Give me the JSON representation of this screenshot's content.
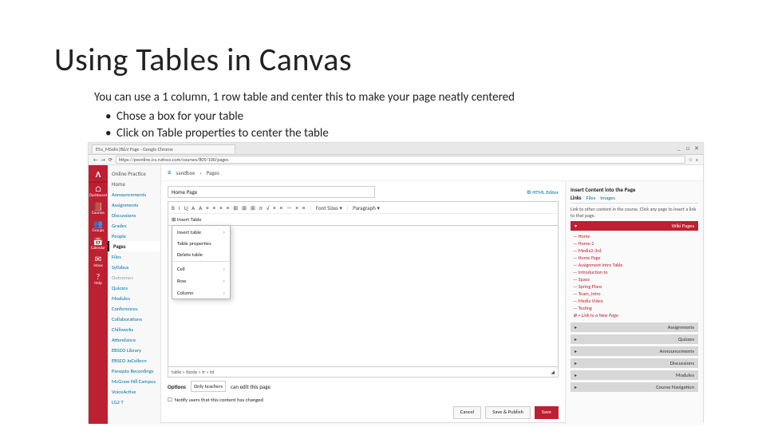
{
  "title": "Using Tables in Canvas",
  "intro": "You can use a 1 column, 1 row table and center this to make your page neatly centered",
  "bullets": [
    "Chose a box for your table",
    "Click on Table properties to center the table"
  ],
  "browser": {
    "tab_title": "E5a_MSolis|B&V Page - Google Chrome",
    "url": "https://pvonline.ics.rutisco.com/courses/805/100/pages",
    "win_icons": [
      "_",
      "□",
      "✕"
    ]
  },
  "rail": [
    {
      "icon": "⌂",
      "label": "Dashboard"
    },
    {
      "icon": "📕",
      "label": "Courses"
    },
    {
      "icon": "👥",
      "label": "Groups"
    },
    {
      "icon": "📅",
      "label": "Calendar"
    },
    {
      "icon": "✉",
      "label": "Inbox"
    },
    {
      "icon": "?",
      "label": "Help"
    }
  ],
  "nav": {
    "head1": "Online Practice",
    "head2": "Home",
    "items": [
      {
        "label": "Announcements"
      },
      {
        "label": "Assignments"
      },
      {
        "label": "Discussions"
      },
      {
        "label": "Grades"
      },
      {
        "label": "People"
      },
      {
        "label": "Pages",
        "active": true
      },
      {
        "label": "Files"
      },
      {
        "label": "Syllabus"
      },
      {
        "label": "Outcomes",
        "dim": true
      },
      {
        "label": "Quizzes"
      },
      {
        "label": "Modules"
      },
      {
        "label": "Conferences"
      },
      {
        "label": "Collaborations"
      },
      {
        "label": "Chiliworks"
      },
      {
        "label": "Attendance"
      },
      {
        "label": "EBSCO Library"
      },
      {
        "label": "EBSCO JoCollecn"
      },
      {
        "label": "Panopto Recordings"
      },
      {
        "label": "McGraw Hill Campus"
      },
      {
        "label": "VoiceActive"
      },
      {
        "label": "LG2 T"
      }
    ]
  },
  "crumb": {
    "course": "sandbox",
    "page": "Pages"
  },
  "page_form": {
    "title_value": "Home Page",
    "html_link": "HTML Editor",
    "fonts_label": "Font Sizes",
    "para_label": "Paragraph",
    "toolbar_icons": [
      "B",
      "I",
      "U̲",
      "A",
      "A",
      "≡",
      "≡",
      "≡",
      "≡",
      "⊞",
      "⊞",
      "⊞",
      "π",
      "√",
      "≡",
      "≡",
      "—",
      "≡",
      "≡"
    ],
    "menu_label": "Insert Table",
    "status_path": "table » tbody » tr » td",
    "options_label": "Options",
    "options_value": "Only teachers",
    "options_suffix": "can edit this page",
    "notify": "Notify users that this content has changed",
    "btn_cancel": "Cancel",
    "btn_pub": "Save & Publish",
    "btn_save": "Save"
  },
  "dropdown": [
    {
      "label": "Insert table",
      "sub": true
    },
    {
      "label": "Table properties"
    },
    {
      "label": "Delete table"
    },
    {
      "hr": true
    },
    {
      "label": "Cell",
      "sub": true
    },
    {
      "label": "Row",
      "sub": true
    },
    {
      "label": "Column",
      "sub": true
    }
  ],
  "insert": {
    "head": "Insert Content into the Page",
    "tabs": [
      "Links",
      "Files",
      "Images"
    ],
    "info": "Link to other content in the course. Click any page to insert a link to that page.",
    "wiki_label": "Wiki Pages",
    "wiki_links": [
      "Home",
      "Home-2",
      "Media2-3rd",
      "Home Page",
      "Assignment Intro Table",
      "Introduction to",
      "Space",
      "Spring Plans",
      "Team_Intro",
      "Media Video",
      "Testing"
    ],
    "add_page": "+ Link to a New Page",
    "acc": [
      "Assignments",
      "Quizzes",
      "Announcements",
      "Discussions",
      "Modules",
      "Course Navigation"
    ]
  }
}
